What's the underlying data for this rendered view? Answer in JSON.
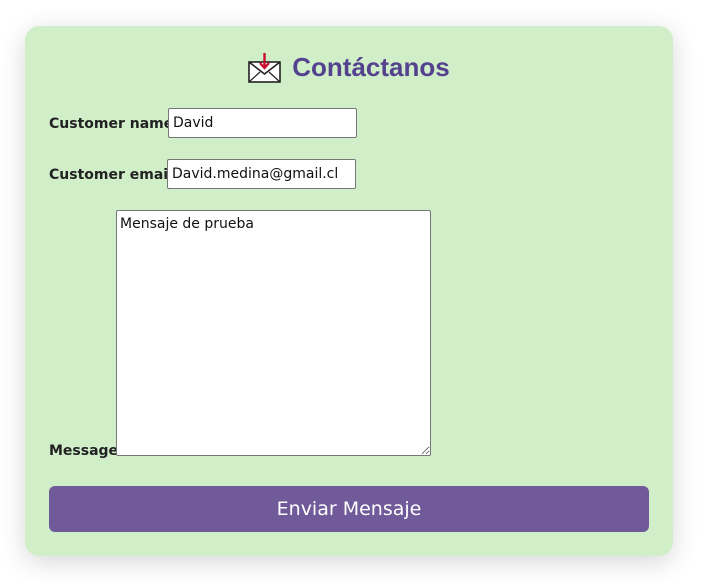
{
  "form": {
    "title": "Contáctanos",
    "icon": "envelope-download-icon",
    "name_label": "Customer name",
    "name_value": "David",
    "email_label": "Customer email",
    "email_value": "David.medina@gmail.cl",
    "message_label": "Message",
    "message_value": "Mensaje de prueba",
    "submit_label": "Enviar Mensaje"
  },
  "colors": {
    "card_background": "#d0efc9",
    "title": "#54428e",
    "button": "#705a9a",
    "button_text": "#ffffff"
  }
}
